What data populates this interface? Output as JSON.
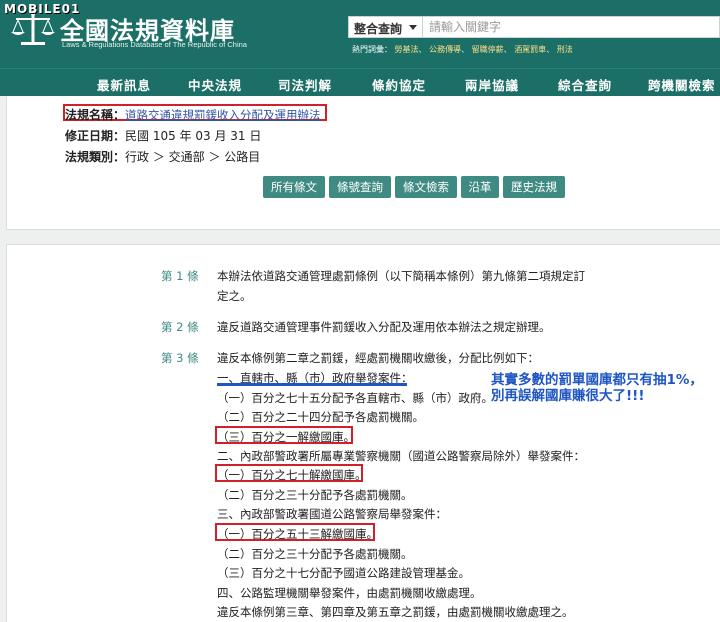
{
  "header": {
    "watermark": "MOBILE01",
    "title": "全國法規資料庫",
    "subtitle": "Laws & Regulations Database of The Republic of China",
    "search": {
      "selected": "整合查詢",
      "placeholder": "請輸入關鍵字"
    },
    "hot_label": "熱門詞彙：",
    "hot_items": [
      "勞基法",
      "公務傳導",
      "留職停薪",
      "酒駕罰車",
      "刑法"
    ]
  },
  "nav": [
    "最新訊息",
    "中央法規",
    "司法判解",
    "條約協定",
    "兩岸協議",
    "綜合查詢",
    "跨機關檢索"
  ],
  "info": {
    "name_label": "法規名稱：",
    "name_value": "道路交通違規罰鍰收入分配及運用辦法",
    "date_label": "修正日期：",
    "date_value": "民國 105 年 03 月 31 日",
    "cat_label": "法規類別：",
    "cat_value": "行政 ＞ 交通部 ＞ 公路目"
  },
  "buttons": [
    "所有條文",
    "條號查詢",
    "條文檢索",
    "沿革",
    "歷史法規"
  ],
  "articles": {
    "a1_no": "第 1 條",
    "a1_l1": "本辦法依道路交通管理處罰條例（以下簡稱本條例）第九條第二項規定訂",
    "a1_l2": "定之。",
    "a2_no": "第 2 條",
    "a2_l1": "違反道路交通管理事件罰鍰收入分配及運用依本辦法之規定辦理。",
    "a3_no": "第 3 條",
    "lines": [
      "違反本條例第二章之罰鍰，經處罰機關收繳後，分配比例如下：",
      "一、直轄市、縣（市）政府舉發案件：",
      "（一）百分之七十五分配予各直轄市、縣（市）政府。",
      "（二）百分之二十四分配予各處罰機關。",
      "（三）百分之一解繳國庫。",
      "二、內政部警政署所屬專業警察機關（國道公路警察局除外）舉發案件：",
      "（一）百分之七十解繳國庫。",
      "（二）百分之三十分配予各處罰機關。",
      "三、內政部警政署國道公路警察局舉發案件：",
      "（一）百分之五十三解繳國庫。",
      "（二）百分之三十分配予各處罰機關。",
      "（三）百分之十七分配予國道公路建設管理基金。",
      "四、公路監理機關舉發案件，由處罰機關收繳處理。",
      "違反本條例第三章、第四章及第五章之罰鍰，由處罰機關收繳處理之。"
    ],
    "note_l1": "其實多數的罰單國庫都只有抽1%，",
    "note_l2": "別再誤解國庫賺很大了!!!"
  }
}
